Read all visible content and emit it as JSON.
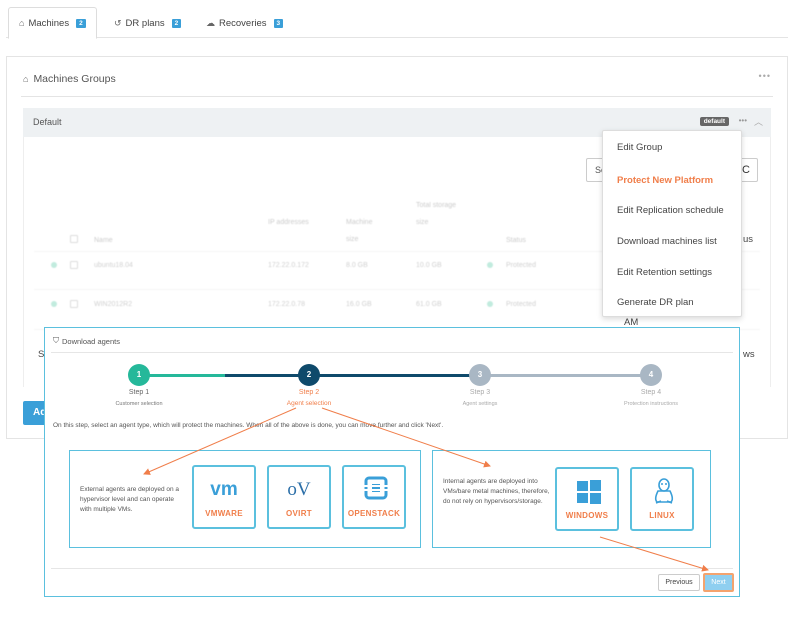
{
  "tabs": [
    {
      "label": "Machines",
      "badge": "2",
      "icon": "home-icon"
    },
    {
      "label": "DR plans",
      "badge": "2",
      "icon": "history-icon"
    },
    {
      "label": "Recoveries",
      "badge": "3",
      "icon": "cloud-icon"
    }
  ],
  "panel": {
    "title": "Machines Groups",
    "dots": "•••"
  },
  "group": {
    "name": "Default",
    "tag": "default",
    "search_fragment": "Se",
    "table": {
      "headers": [
        "Name",
        "IP addresses",
        "Machine size",
        "Total storage size",
        "Status"
      ],
      "rows": [
        {
          "name": "ubuntu18.04",
          "ip": "172.22.0.172",
          "machine_size": "8.0 GB",
          "storage": "10.0 GB",
          "status": "Protected"
        },
        {
          "name": "WIN2012R2",
          "ip": "172.22.0.78",
          "machine_size": "16.0 GB",
          "storage": "61.0 GB",
          "status": "Protected"
        }
      ]
    },
    "right_fragments": {
      "status_suffix": "us",
      "time": "AM",
      "view_suffix": "ws"
    },
    "left_fragment": "S",
    "add_button": "Add"
  },
  "menu": {
    "items": [
      {
        "label": "Edit Group",
        "highlight": false
      },
      {
        "label": "Protect New Platform",
        "highlight": true
      },
      {
        "label": "Edit Replication schedule",
        "highlight": false
      },
      {
        "label": "Download machines list",
        "highlight": false
      },
      {
        "label": "Edit Retention settings",
        "highlight": false
      },
      {
        "label": "Generate DR plan",
        "highlight": false
      }
    ]
  },
  "wizard": {
    "title": "Download agents",
    "steps": [
      {
        "number": "1",
        "label": "Step 1",
        "sub": "Customer selection",
        "state": "done"
      },
      {
        "number": "2",
        "label": "Step 2",
        "sub": "Agent selection",
        "state": "current"
      },
      {
        "number": "3",
        "label": "Step 3",
        "sub": "Agent settings",
        "state": "todo"
      },
      {
        "number": "4",
        "label": "Step 4",
        "sub": "Protection instructions",
        "state": "todo"
      }
    ],
    "instruction": "On this step, select an agent type, which will protect the machines. When all of the above is done, you can move further and click 'Next'.",
    "external": {
      "text": "External agents are deployed on a hypervisor level and can operate with multiple VMs.",
      "agents": [
        {
          "label": "VMWARE",
          "logo": "vm"
        },
        {
          "label": "OVIRT",
          "logo": "oV"
        },
        {
          "label": "OPENSTACK",
          "logo": "openstack-icon"
        }
      ]
    },
    "internal": {
      "text": "Internal agents are deployed into VMs/bare metal machines, therefore, do not rely on hypervisors/storage.",
      "agents": [
        {
          "label": "WINDOWS",
          "logo": "windows-icon"
        },
        {
          "label": "LINUX",
          "logo": "linux-penguin-icon"
        }
      ]
    },
    "buttons": {
      "previous": "Previous",
      "next": "Next"
    }
  },
  "colors": {
    "accent": "#3a9fd8",
    "highlight": "#f07e4a",
    "step_done": "#25b89a",
    "step_current": "#0f4a6b",
    "step_todo": "#a9b7c4",
    "wizard_border": "#5bc0de"
  }
}
